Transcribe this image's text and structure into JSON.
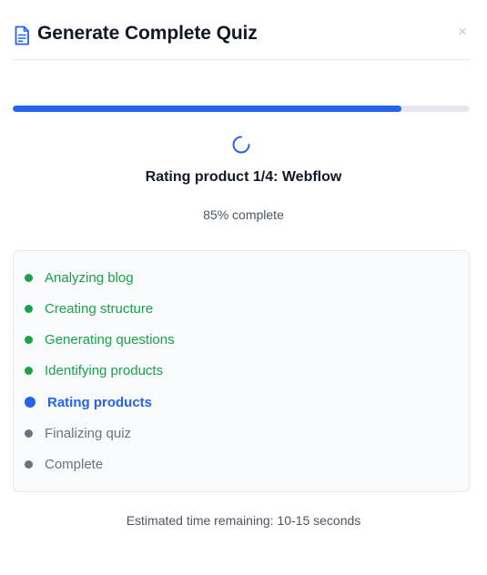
{
  "dialog": {
    "title": "Generate Complete Quiz",
    "close_label": "×",
    "icons": {
      "title": "document-icon",
      "close": "close-icon",
      "spinner": "loading-spinner-icon"
    }
  },
  "progress": {
    "value": 0.85,
    "status": "Rating product 1/4: Webflow",
    "percent_text": "85% complete"
  },
  "steps": [
    {
      "label": "Analyzing blog",
      "state": "done"
    },
    {
      "label": "Creating structure",
      "state": "done"
    },
    {
      "label": "Generating questions",
      "state": "done"
    },
    {
      "label": "Identifying products",
      "state": "done"
    },
    {
      "label": "Rating products",
      "state": "active"
    },
    {
      "label": "Finalizing quiz",
      "state": "pending"
    },
    {
      "label": "Complete",
      "state": "pending"
    }
  ],
  "eta": "Estimated time remaining: 10-15 seconds",
  "colors": {
    "accent": "#2563eb",
    "done": "#16a34a",
    "pending": "#6b7280",
    "track": "#e5e7eb"
  }
}
